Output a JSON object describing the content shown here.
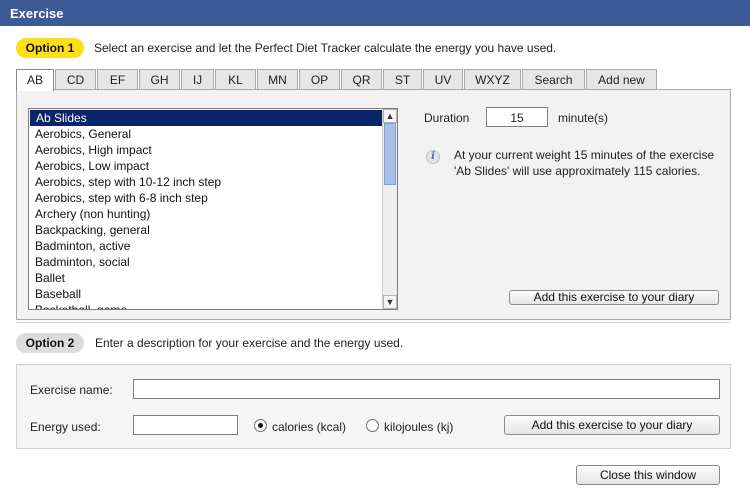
{
  "window": {
    "title": "Exercise"
  },
  "option1": {
    "badge": "Option 1",
    "description": "Select an exercise and let the Perfect Diet Tracker calculate the energy you have used."
  },
  "tabs": [
    "AB",
    "CD",
    "EF",
    "GH",
    "IJ",
    "KL",
    "MN",
    "OP",
    "QR",
    "ST",
    "UV",
    "WXYZ",
    "Search",
    "Add new"
  ],
  "active_tab": "AB",
  "exercise_list": {
    "items": [
      "Ab Slides",
      "Aerobics, General",
      "Aerobics, High impact",
      "Aerobics, Low impact",
      "Aerobics, step with 10-12 inch step",
      "Aerobics, step with 6-8 inch step",
      "Archery (non hunting)",
      "Backpacking, general",
      "Badminton, active",
      "Badminton, social",
      "Ballet",
      "Baseball",
      "Basketball, game"
    ],
    "selected": "Ab Slides"
  },
  "duration": {
    "label": "Duration",
    "value": "15",
    "unit": "minute(s)"
  },
  "info": {
    "icon": "info-icon",
    "text": "At your current weight 15 minutes of the exercise 'Ab Slides' will use approximately 115 calories."
  },
  "add_button_1": "Add this exercise to your diary",
  "option2": {
    "badge": "Option 2",
    "description": "Enter a description for your exercise and the energy used."
  },
  "form": {
    "exercise_name_label": "Exercise name:",
    "exercise_name_value": "",
    "energy_label": "Energy used:",
    "energy_value": "",
    "unit_calories": "calories (kcal)",
    "unit_kilojoules": "kilojoules (kj)",
    "selected_unit": "calories (kcal)",
    "add_button": "Add this exercise to your diary"
  },
  "close_button": "Close this window",
  "colors": {
    "titlebar": "#3c5a98",
    "option1_badge": "#ffde1a",
    "option2_badge": "#dcdcdc",
    "selection": "#0a246a"
  }
}
